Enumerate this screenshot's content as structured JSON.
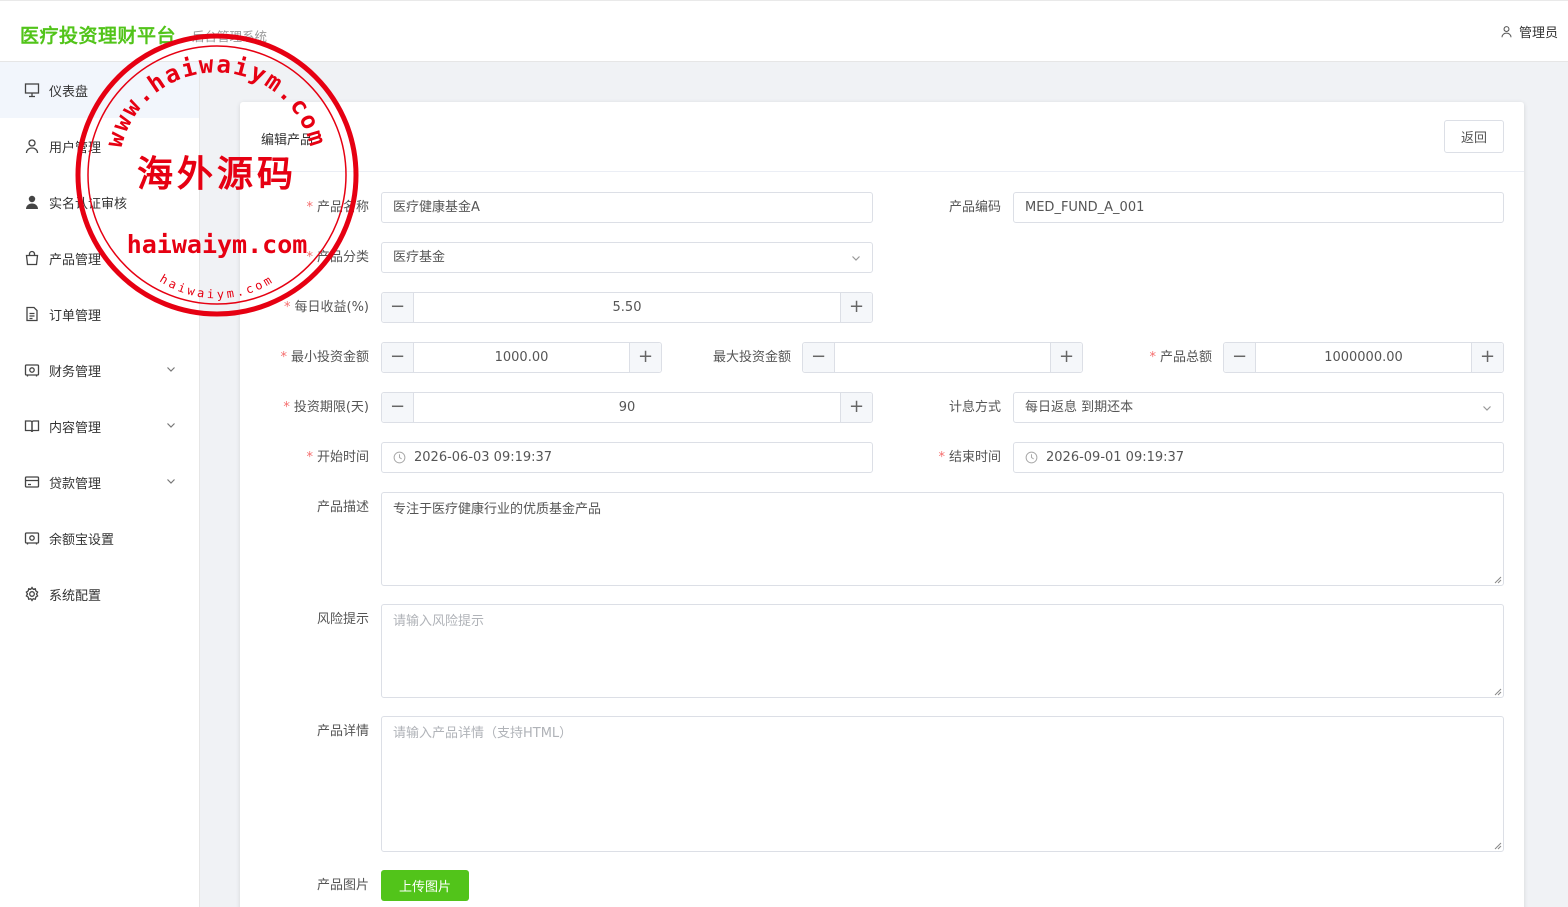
{
  "header": {
    "brand": "医疗投资理财平台",
    "subtitle": "后台管理系统",
    "user": "管理员"
  },
  "sidebar": {
    "items": [
      {
        "label": "仪表盘",
        "icon": "presentation-board-icon",
        "active": true
      },
      {
        "label": "用户管理",
        "icon": "user-icon"
      },
      {
        "label": "实名认证审核",
        "icon": "user-filled-icon"
      },
      {
        "label": "产品管理",
        "icon": "shopping-bag-icon"
      },
      {
        "label": "订单管理",
        "icon": "document-icon"
      },
      {
        "label": "财务管理",
        "icon": "wallet-icon",
        "expandable": true
      },
      {
        "label": "内容管理",
        "icon": "book-icon",
        "expandable": true
      },
      {
        "label": "贷款管理",
        "icon": "credit-card-icon",
        "expandable": true
      },
      {
        "label": "余额宝设置",
        "icon": "wallet-icon"
      },
      {
        "label": "系统配置",
        "icon": "gear-icon"
      }
    ]
  },
  "page": {
    "title": "编辑产品",
    "back_label": "返回"
  },
  "form": {
    "name": {
      "label": "产品名称",
      "value": "医疗健康基金A",
      "required": true
    },
    "code": {
      "label": "产品编码",
      "value": "MED_FUND_A_001"
    },
    "category": {
      "label": "产品分类",
      "value": "医疗基金",
      "required": true
    },
    "daily_rate": {
      "label": "每日收益(%)",
      "value": "5.50",
      "required": true
    },
    "min_invest": {
      "label": "最小投资金额",
      "value": "1000.00",
      "required": true
    },
    "max_invest": {
      "label": "最大投资金额",
      "value": ""
    },
    "total": {
      "label": "产品总额",
      "value": "1000000.00",
      "required": true
    },
    "period": {
      "label": "投资期限(天)",
      "value": "90",
      "required": true
    },
    "interest_method": {
      "label": "计息方式",
      "value": "每日返息 到期还本"
    },
    "start_time": {
      "label": "开始时间",
      "value": "2026-06-03 09:19:37",
      "required": true
    },
    "end_time": {
      "label": "结束时间",
      "value": "2026-09-01 09:19:37",
      "required": true
    },
    "description": {
      "label": "产品描述",
      "value": "专注于医疗健康行业的优质基金产品"
    },
    "risk": {
      "label": "风险提示",
      "placeholder": "请输入风险提示"
    },
    "details": {
      "label": "产品详情",
      "placeholder": "请输入产品详情（支持HTML）"
    },
    "image": {
      "label": "产品图片",
      "button": "上传图片"
    }
  },
  "watermark": {
    "top_arc": "www.haiwaiym.com",
    "center": "海外源码",
    "domain": "haiwaiym.com",
    "bottom_arc": "haiwaiym.com",
    "color": "#e60012"
  },
  "colors": {
    "brand": "#52c41a",
    "required": "#f56c6c",
    "stamp": "#e60012"
  }
}
